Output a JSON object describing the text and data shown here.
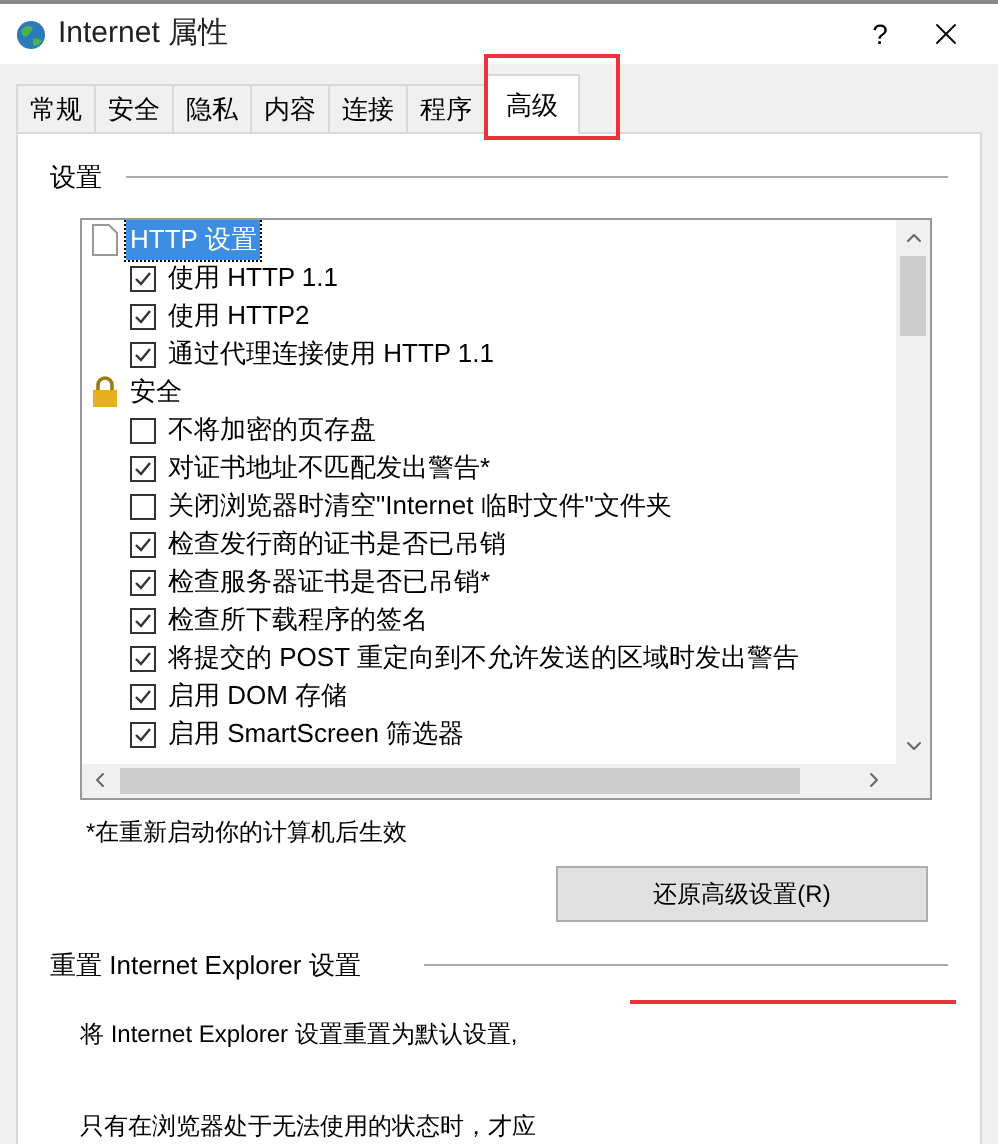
{
  "window": {
    "title": "Internet 属性",
    "help": "?"
  },
  "tabs": [
    {
      "label": "常规",
      "selected": false
    },
    {
      "label": "安全",
      "selected": false
    },
    {
      "label": "隐私",
      "selected": false
    },
    {
      "label": "内容",
      "selected": false
    },
    {
      "label": "连接",
      "selected": false
    },
    {
      "label": "程序",
      "selected": false
    },
    {
      "label": "高级",
      "selected": true
    }
  ],
  "settings": {
    "label": "设置",
    "tree": [
      {
        "kind": "page-category",
        "label": "HTTP 设置",
        "selected": true,
        "children": [
          {
            "label": "使用 HTTP 1.1",
            "checked": true
          },
          {
            "label": "使用 HTTP2",
            "checked": true
          },
          {
            "label": "通过代理连接使用 HTTP 1.1",
            "checked": true
          }
        ]
      },
      {
        "kind": "lock-category",
        "label": "安全",
        "selected": false,
        "children": [
          {
            "label": "不将加密的页存盘",
            "checked": false
          },
          {
            "label": "对证书地址不匹配发出警告*",
            "checked": true
          },
          {
            "label": "关闭浏览器时清空\"Internet 临时文件\"文件夹",
            "checked": false
          },
          {
            "label": "检查发行商的证书是否已吊销",
            "checked": true
          },
          {
            "label": "检查服务器证书是否已吊销*",
            "checked": true
          },
          {
            "label": "检查所下载程序的签名",
            "checked": true
          },
          {
            "label": "将提交的 POST 重定向到不允许发送的区域时发出警告",
            "checked": true
          },
          {
            "label": "启用 DOM 存储",
            "checked": true
          },
          {
            "label": "启用 SmartScreen 筛选器",
            "checked": true
          }
        ]
      }
    ]
  },
  "note": "*在重新启动你的计算机后生效",
  "restore_button": "还原高级设置(R)",
  "reset": {
    "label": "重置 Internet Explorer 设置",
    "lines": [
      "将 Internet Explorer 设置重置为默认设置,",
      "只有在浏览器处于无法使用的状态时，才应"
    ]
  }
}
